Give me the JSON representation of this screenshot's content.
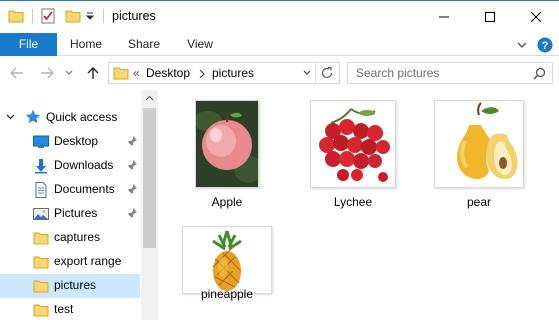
{
  "window": {
    "title": "pictures"
  },
  "ribbon": {
    "tabs": [
      "File",
      "Home",
      "Share",
      "View"
    ]
  },
  "address": {
    "overflow": "«",
    "crumbs": [
      "Desktop",
      "pictures"
    ]
  },
  "search": {
    "placeholder": "Search pictures"
  },
  "nav": {
    "quick_access": "Quick access",
    "items": [
      {
        "label": "Desktop",
        "icon": "desktop-icon",
        "pinned": true
      },
      {
        "label": "Downloads",
        "icon": "downloads-icon",
        "pinned": true
      },
      {
        "label": "Documents",
        "icon": "documents-icon",
        "pinned": true
      },
      {
        "label": "Pictures",
        "icon": "pictures-icon",
        "pinned": true
      },
      {
        "label": "captures",
        "icon": "folder-icon",
        "pinned": false
      },
      {
        "label": "export range",
        "icon": "folder-icon",
        "pinned": false
      },
      {
        "label": "pictures",
        "icon": "folder-icon",
        "pinned": false,
        "selected": true
      },
      {
        "label": "test",
        "icon": "folder-icon",
        "pinned": false
      }
    ]
  },
  "files": [
    {
      "name": "Apple",
      "icon": "apple-thumbnail"
    },
    {
      "name": "Lychee",
      "icon": "lychee-thumbnail"
    },
    {
      "name": "pear",
      "icon": "pear-thumbnail"
    },
    {
      "name": "pineapple",
      "icon": "pineapple-thumbnail"
    }
  ],
  "colors": {
    "accent": "#1979ca",
    "selection": "#cce8ff",
    "folder": "#f8d775"
  }
}
